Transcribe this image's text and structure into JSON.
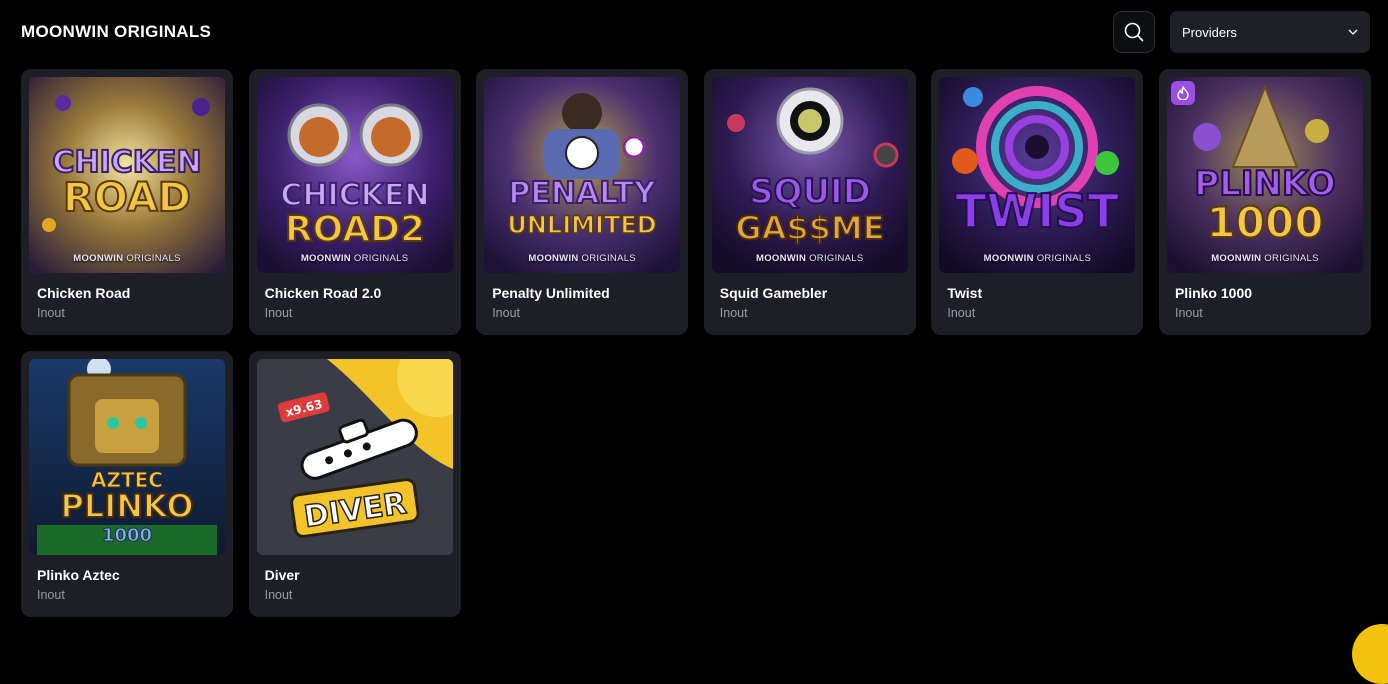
{
  "header": {
    "title": "MOONWIN ORIGINALS",
    "providers_label": "Providers"
  },
  "games": [
    {
      "name": "Chicken Road",
      "provider": "Inout",
      "art_line1": "CHICKEN",
      "art_line2": "ROAD",
      "brand_bold": "MOONWIN",
      "brand_light": "ORIGINALS",
      "hot": false
    },
    {
      "name": "Chicken Road 2.0",
      "provider": "Inout",
      "art_line1": "CHICKEN",
      "art_line2": "ROAD2",
      "brand_bold": "MOONWIN",
      "brand_light": "ORIGINALS",
      "hot": false
    },
    {
      "name": "Penalty Unlimited",
      "provider": "Inout",
      "art_line1": "PENALTY",
      "art_line2": "UNLIMITED",
      "brand_bold": "MOONWIN",
      "brand_light": "ORIGINALS",
      "hot": false
    },
    {
      "name": "Squid Gamebler",
      "provider": "Inout",
      "art_line1": "SQUID",
      "art_line2": "GA$$ME",
      "brand_bold": "MOONWIN",
      "brand_light": "ORIGINALS",
      "hot": false
    },
    {
      "name": "Twist",
      "provider": "Inout",
      "art_line1": "TWIST",
      "art_line2": "",
      "brand_bold": "MOONWIN",
      "brand_light": "ORIGINALS",
      "hot": false
    },
    {
      "name": "Plinko 1000",
      "provider": "Inout",
      "art_line1": "PLINKO",
      "art_line2": "1000",
      "brand_bold": "MOONWIN",
      "brand_light": "ORIGINALS",
      "hot": true
    },
    {
      "name": "Plinko Aztec",
      "provider": "Inout",
      "art_line1": "AZTEC",
      "art_line2": "PLINKO",
      "art_line3": "1000",
      "hot": false
    },
    {
      "name": "Diver",
      "provider": "Inout",
      "art_line1": "DIVER",
      "art_badge": "x9.63",
      "hot": false
    }
  ]
}
